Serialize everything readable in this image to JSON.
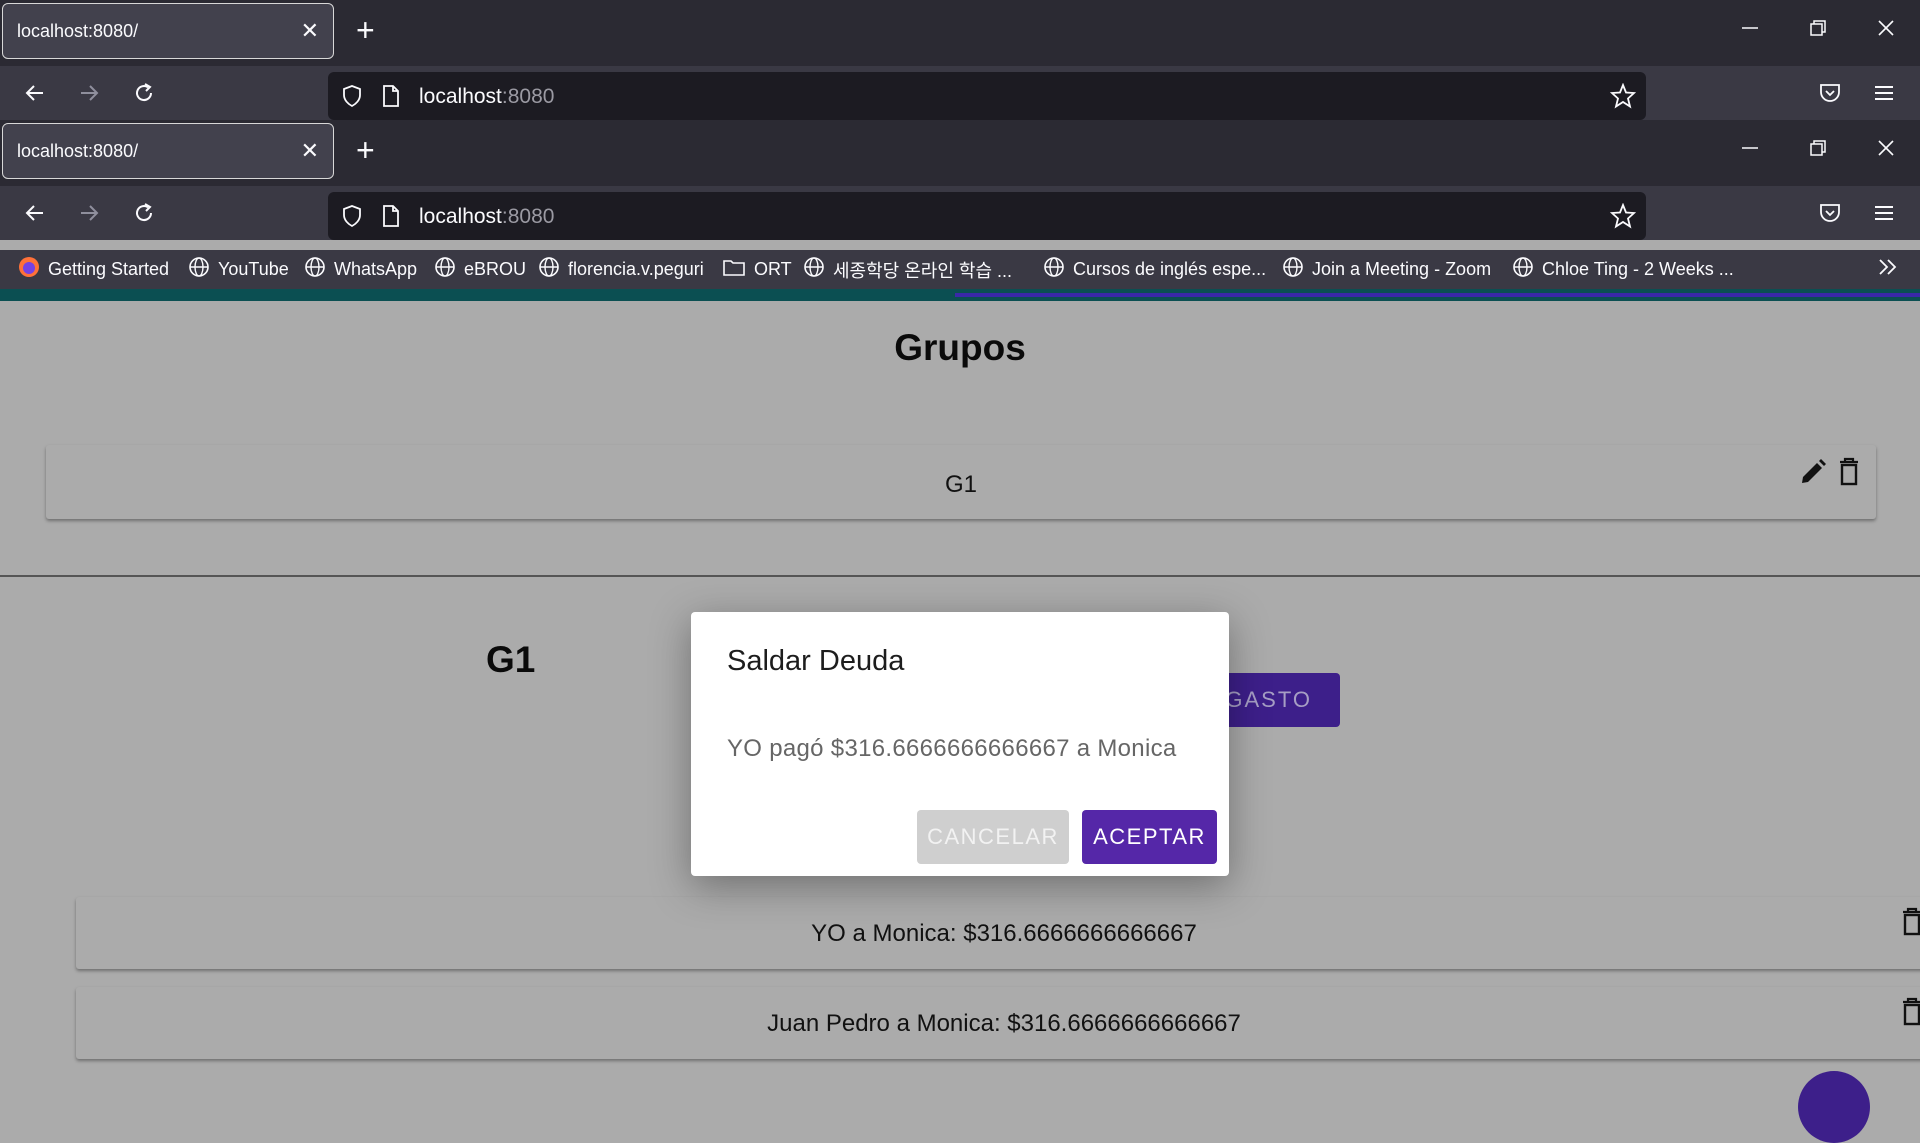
{
  "browser": {
    "windows": [
      {
        "tab_title": "localhost:8080/",
        "url_host": "localhost",
        "url_port": ":8080"
      },
      {
        "tab_title": "localhost:8080/",
        "url_host": "localhost",
        "url_port": ":8080"
      }
    ],
    "bookmarks": [
      {
        "label": "Getting Started",
        "icon": "firefox-icon"
      },
      {
        "label": "YouTube",
        "icon": "globe-icon"
      },
      {
        "label": "WhatsApp",
        "icon": "globe-icon"
      },
      {
        "label": "eBROU",
        "icon": "globe-icon"
      },
      {
        "label": "florencia.v.peguri",
        "icon": "globe-icon"
      },
      {
        "label": "ORT",
        "icon": "folder-icon"
      },
      {
        "label": "세종학당 온라인 학습 ...",
        "icon": "globe-icon"
      },
      {
        "label": "Cursos de inglés espe...",
        "icon": "globe-icon"
      },
      {
        "label": "Join a Meeting - Zoom",
        "icon": "globe-icon"
      },
      {
        "label": "Chloe Ting - 2 Weeks ...",
        "icon": "globe-icon"
      }
    ]
  },
  "page": {
    "title": "Grupos",
    "groups": [
      {
        "name": "G1"
      }
    ],
    "section_title": "G1",
    "gasto_button": "GASTO",
    "debts": [
      {
        "text": "YO a Monica: $316.6666666666667"
      },
      {
        "text": "Juan Pedro a Monica: $316.6666666666667"
      }
    ]
  },
  "dialog": {
    "title": "Saldar Deuda",
    "body": "YO pagó $316.6666666666667 a Monica",
    "cancel_label": "CANCELAR",
    "accept_label": "ACEPTAR"
  },
  "colors": {
    "chrome_dark": "#2b2a33",
    "chrome_nav": "#3a3944",
    "overlay_gray": "#ababab",
    "primary_purple": "#5527a8"
  }
}
